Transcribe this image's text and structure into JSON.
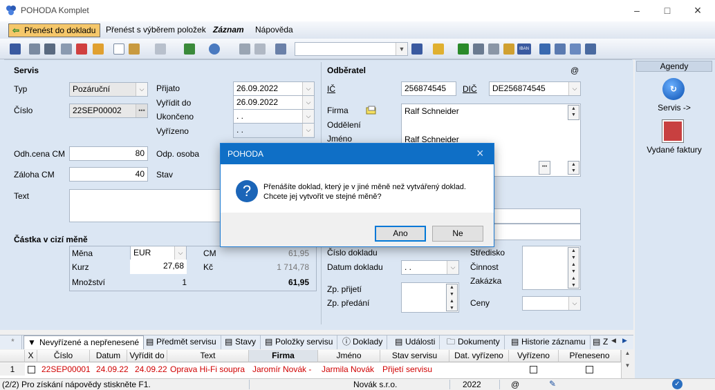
{
  "window": {
    "title": "POHODA Komplet",
    "min_icon": "minimize-icon",
    "max_icon": "maximize-icon",
    "close_icon": "close-icon"
  },
  "menu": {
    "items": [
      "Přenést do dokladu",
      "Přenést s výběrem položek",
      "Záznam",
      "Nápověda"
    ]
  },
  "servis": {
    "header": "Servis",
    "typ_label": "Typ",
    "typ_value": "Pozáruční",
    "cislo_label": "Číslo",
    "cislo_value": "22SEP00002",
    "prijato_label": "Přijato",
    "prijato_value": "26.09.2022",
    "vyridit_label": "Vyřídit do",
    "vyridit_value": "26.09.2022",
    "ukonceno_label": "Ukončeno",
    "ukonceno_value": ". .",
    "vyrizeno_label": "Vyřízeno",
    "vyrizeno_value": ". .",
    "odhcena_label": "Odh.cena CM",
    "odhcena_value": "80",
    "odposoba_label": "Odp. osoba",
    "zaloha_label": "Záloha CM",
    "zaloha_value": "40",
    "stav_label": "Stav",
    "text_label": "Text"
  },
  "cizi_mena": {
    "header": "Částka v cizí měně",
    "mena_label": "Měna",
    "mena_value": "EUR",
    "cm_label": "CM",
    "cm_value": "61,95",
    "kurz_label": "Kurz",
    "kurz_value": "27,68",
    "kc_label": "Kč",
    "kc_value": "1 714,78",
    "mnozstvi_label": "Množství",
    "mnozstvi_value": "1",
    "total_value": "61,95"
  },
  "odberatel": {
    "header": "Odběratel",
    "at_symbol": "@",
    "ic_label": "IČ",
    "ic_value": "256874545",
    "dic_label": "DIČ",
    "dic_value": "DE256874545",
    "firma_label": "Firma",
    "firma_value": "Ralf Schneider",
    "oddeleni_label": "Oddělení",
    "jmeno_label": "Jméno",
    "jmeno_value": "Ralf Schneider",
    "cislo_dokladu_label": "Číslo dokladu",
    "datum_dokladu_label": "Datum dokladu",
    "datum_dokladu_value": ". .",
    "zp_prijeti_label": "Zp. přijetí",
    "zp_predani_label": "Zp. předání",
    "stredisko_label": "Středisko",
    "cinnost_label": "Činnost",
    "zakazka_label": "Zakázka",
    "ceny_label": "Ceny"
  },
  "agenda": {
    "header": "Agendy",
    "items": [
      "Servis ->",
      "Vydané faktury"
    ]
  },
  "tabs": [
    "*",
    "Nevyřízené a nepřenesené",
    "Předmět servisu",
    "Stavy",
    "Položky servisu",
    "Doklady",
    "Události",
    "Dokumenty",
    "Historie záznamu",
    "Z"
  ],
  "grid": {
    "headers": [
      "",
      "X",
      "Číslo",
      "Datum",
      "Vyřídit do",
      "Text",
      "Firma",
      "Jméno",
      "Stav servisu",
      "Dat. vyřízeno",
      "Vyřízeno",
      "Přeneseno"
    ],
    "row": {
      "num": "1",
      "cislo": "22SEP00001",
      "datum": "24.09.22",
      "vyridit": "24.09.22",
      "text": "Oprava Hi-Fi soupra",
      "firma": "Jaromír Novák -",
      "jmeno": "Jarmila Novák",
      "stav": "Přijetí servisu"
    }
  },
  "status": {
    "hint": "(2/2) Pro získání nápovědy stiskněte F1.",
    "company": "Novák s.r.o.",
    "year": "2022",
    "at": "@"
  },
  "dialog": {
    "title": "POHODA",
    "line1": "Přenášíte doklad, který je v jiné měně než vytvářený doklad.",
    "line2": "Chcete jej vytvořit ve stejné měně?",
    "yes": "Ano",
    "no": "Ne",
    "icon": "question-icon",
    "close": "×"
  },
  "colors": {
    "accent": "#0f6fc6",
    "panel": "#dbe6f3",
    "highlight": "#f5c76a",
    "grid_text": "#d00000"
  }
}
